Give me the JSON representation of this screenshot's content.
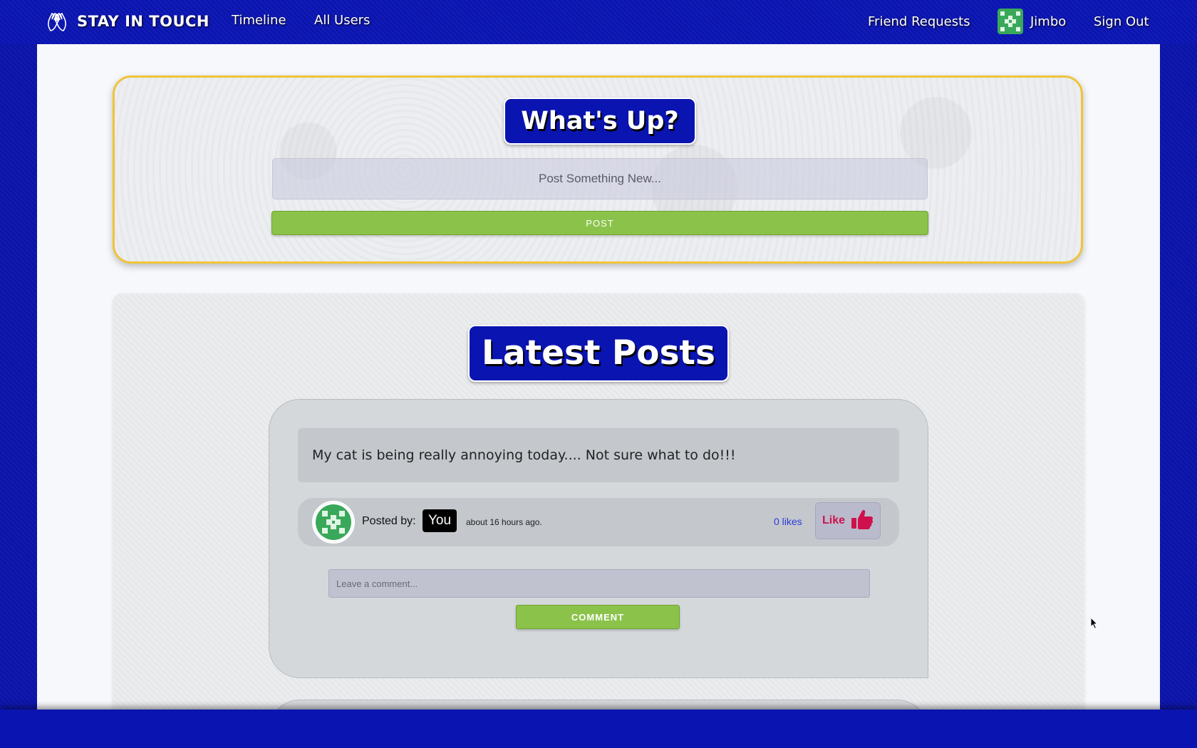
{
  "navbar": {
    "brand": "STAY IN TOUCH",
    "timeline": "Timeline",
    "all_users": "All Users",
    "friend_requests": "Friend Requests",
    "user_name": "Jimbo",
    "sign_out": "Sign Out",
    "brand_icon": "hands-icon",
    "avatar_color": "#3aa85a"
  },
  "whats_up": {
    "title": "What's Up?",
    "input_placeholder": "Post Something New...",
    "post_button": "POST"
  },
  "latest_posts": {
    "title": "Latest Posts",
    "posts": [
      {
        "body": "My cat is being really annoying today.... Not sure what to do!!!",
        "posted_by_label": "Posted by:",
        "author": "You",
        "time": "about 16 hours ago.",
        "likes": "0 likes",
        "like_button": "Like",
        "comment_placeholder": "Leave a comment...",
        "comment_button": "COMMENT"
      }
    ]
  },
  "colors": {
    "brand_blue": "#0a14b0",
    "accent_green": "#8bc34a",
    "border_gold": "#f0c43a",
    "like_red": "#d0104c"
  }
}
